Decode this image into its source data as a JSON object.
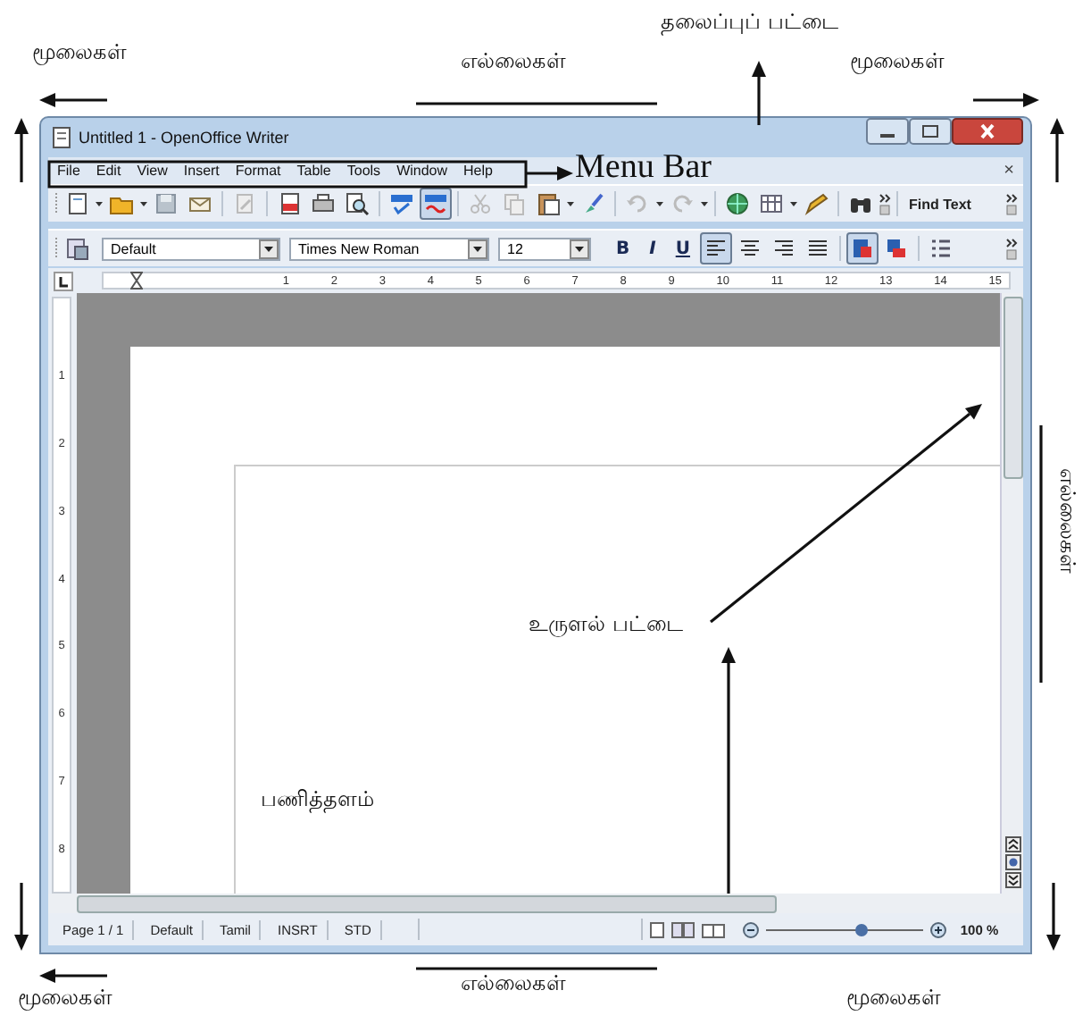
{
  "annotations": [
    "மூலைகள்",
    "எல்லைகள்",
    "தலைப்புப் பட்டை",
    "மூலைகள்",
    "Menu Bar",
    "எல்லைகள்",
    "உருளல் பட்டை",
    "பணித்தளம்",
    "எல்லைகள்",
    "மூலைகள்",
    "மூலைகள்"
  ],
  "window": {
    "title": "Untitled 1 - OpenOffice Writer",
    "menu": [
      "File",
      "Edit",
      "View",
      "Insert",
      "Format",
      "Table",
      "Tools",
      "Window",
      "Help"
    ],
    "close_document": "×",
    "standard_toolbar": [
      {
        "pressed": false
      },
      {
        "pressed": false
      },
      {
        "pressed": false
      },
      {
        "pressed": false
      },
      {
        "pressed": false
      },
      {
        "pressed": false
      },
      {
        "pressed": false
      },
      {
        "pressed": false
      },
      {
        "pressed": false
      },
      {
        "pressed": true
      },
      {
        "pressed": false
      },
      {
        "pressed": false
      },
      {
        "pressed": false
      },
      {
        "pressed": false
      },
      {
        "pressed": false
      },
      {
        "pressed": false
      },
      {
        "pressed": false
      },
      {
        "pressed": false
      },
      {
        "pressed": false
      }
    ],
    "find_text": "Find Text",
    "format_bar": {
      "style": "Default",
      "font": "Times New Roman",
      "size": "12"
    },
    "format_buttons": [
      {
        "label": "B",
        "pressed": false
      },
      {
        "label": "I",
        "pressed": false
      },
      {
        "label": "U",
        "pressed": false
      }
    ],
    "align_buttons": [
      {
        "pressed": true
      },
      {
        "pressed": false
      },
      {
        "pressed": false
      },
      {
        "pressed": false
      },
      {
        "pressed": true
      },
      {
        "pressed": false
      },
      {
        "pressed": false
      }
    ],
    "ruler_marks": [
      "1",
      "2",
      "3",
      "4",
      "5",
      "6",
      "7",
      "8",
      "9",
      "10",
      "11",
      "12",
      "13",
      "14",
      "15"
    ],
    "vertical_ruler_marks": [
      "1",
      "2",
      "3",
      "4",
      "5",
      "6",
      "7",
      "8"
    ],
    "status_bar": [
      "Page 1 / 1",
      "Default",
      "Tamil",
      "INSRT",
      "STD"
    ],
    "zoom": {
      "level": 0.6,
      "reading": "100 %"
    }
  }
}
